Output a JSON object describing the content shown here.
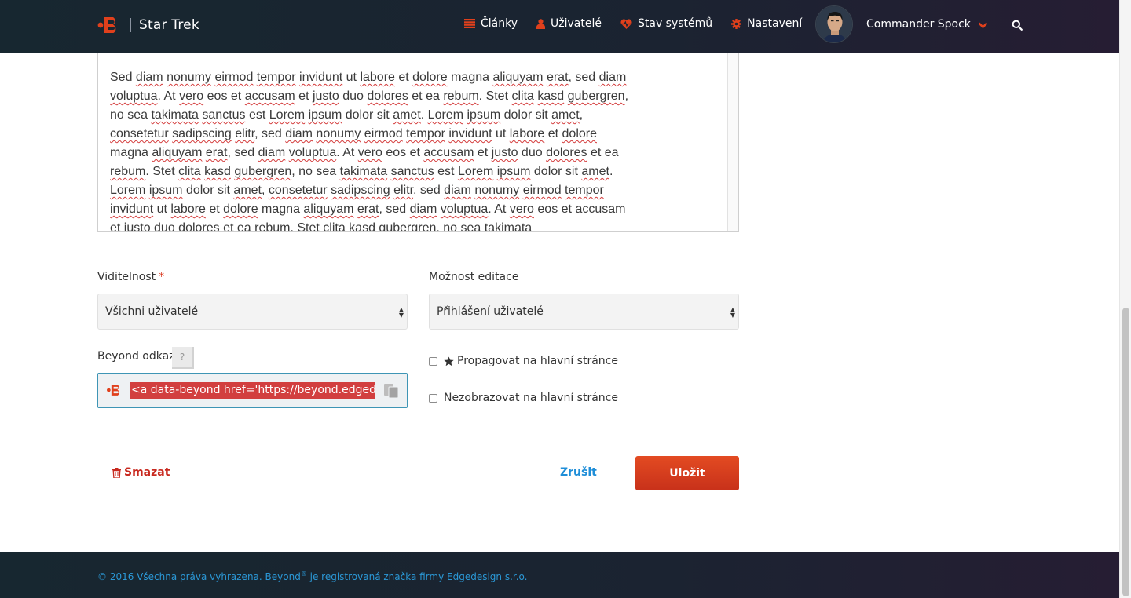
{
  "header": {
    "brand_title": "Star Trek",
    "nav": [
      {
        "label": "Články",
        "icon": "list-icon"
      },
      {
        "label": "Uživatelé",
        "icon": "user-icon"
      },
      {
        "label": "Stav systémů",
        "icon": "heartbeat-icon"
      },
      {
        "label": "Nastavení",
        "icon": "gear-icon"
      }
    ],
    "user_name": "Commander Spock",
    "accent_color": "#e0401c"
  },
  "editor": {
    "paragraph": [
      {
        "t": "Sed ",
        "s": false
      },
      {
        "t": "diam",
        "s": true
      },
      {
        "t": " ",
        "s": false
      },
      {
        "t": "nonumy",
        "s": true
      },
      {
        "t": " ",
        "s": false
      },
      {
        "t": "eirmod",
        "s": true
      },
      {
        "t": " ",
        "s": false
      },
      {
        "t": "tempor",
        "s": true
      },
      {
        "t": " ",
        "s": false
      },
      {
        "t": "invidunt",
        "s": true
      },
      {
        "t": " ut ",
        "s": false
      },
      {
        "t": "labore",
        "s": true
      },
      {
        "t": " et ",
        "s": false
      },
      {
        "t": "dolore",
        "s": true
      },
      {
        "t": " magna ",
        "s": false
      },
      {
        "t": "aliquyam",
        "s": true
      },
      {
        "t": " ",
        "s": false
      },
      {
        "t": "erat",
        "s": true
      },
      {
        "t": ", sed ",
        "s": false
      },
      {
        "t": "diam",
        "s": true
      },
      {
        "t": " ",
        "s": false
      },
      {
        "t": "voluptua",
        "s": true
      },
      {
        "t": ". At ",
        "s": false
      },
      {
        "t": "vero",
        "s": true
      },
      {
        "t": " eos et ",
        "s": false
      },
      {
        "t": "accusam",
        "s": true
      },
      {
        "t": " et ",
        "s": false
      },
      {
        "t": "justo",
        "s": true
      },
      {
        "t": " duo ",
        "s": false
      },
      {
        "t": "dolores",
        "s": true
      },
      {
        "t": " et ea ",
        "s": false
      },
      {
        "t": "rebum",
        "s": true
      },
      {
        "t": ". Stet ",
        "s": false
      },
      {
        "t": "clita",
        "s": true
      },
      {
        "t": " ",
        "s": false
      },
      {
        "t": "kasd",
        "s": true
      },
      {
        "t": " ",
        "s": false
      },
      {
        "t": "gubergren",
        "s": true
      },
      {
        "t": ", no sea ",
        "s": false
      },
      {
        "t": "takimata",
        "s": true
      },
      {
        "t": " ",
        "s": false
      },
      {
        "t": "sanctus",
        "s": true
      },
      {
        "t": " est ",
        "s": false
      },
      {
        "t": "Lorem",
        "s": true
      },
      {
        "t": " ",
        "s": false
      },
      {
        "t": "ipsum",
        "s": true
      },
      {
        "t": " dolor sit ",
        "s": false
      },
      {
        "t": "amet",
        "s": true
      },
      {
        "t": ". ",
        "s": false
      },
      {
        "t": "Lorem",
        "s": true
      },
      {
        "t": " ",
        "s": false
      },
      {
        "t": "ipsum",
        "s": true
      },
      {
        "t": " dolor sit ",
        "s": false
      },
      {
        "t": "amet",
        "s": true
      },
      {
        "t": ", ",
        "s": false
      },
      {
        "t": "consetetur",
        "s": true
      },
      {
        "t": " ",
        "s": false
      },
      {
        "t": "sadipscing",
        "s": true
      },
      {
        "t": " ",
        "s": false
      },
      {
        "t": "elitr",
        "s": true
      },
      {
        "t": ", sed ",
        "s": false
      },
      {
        "t": "diam",
        "s": true
      },
      {
        "t": " ",
        "s": false
      },
      {
        "t": "nonumy",
        "s": true
      },
      {
        "t": " ",
        "s": false
      },
      {
        "t": "eirmod",
        "s": true
      },
      {
        "t": " ",
        "s": false
      },
      {
        "t": "tempor",
        "s": true
      },
      {
        "t": " ",
        "s": false
      },
      {
        "t": "invidunt",
        "s": true
      },
      {
        "t": " ut ",
        "s": false
      },
      {
        "t": "labore",
        "s": true
      },
      {
        "t": " et ",
        "s": false
      },
      {
        "t": "dolore",
        "s": true
      },
      {
        "t": " magna ",
        "s": false
      },
      {
        "t": "aliquyam",
        "s": true
      },
      {
        "t": " ",
        "s": false
      },
      {
        "t": "erat",
        "s": true
      },
      {
        "t": ", sed ",
        "s": false
      },
      {
        "t": "diam",
        "s": true
      },
      {
        "t": " ",
        "s": false
      },
      {
        "t": "voluptua",
        "s": true
      },
      {
        "t": ". At ",
        "s": false
      },
      {
        "t": "vero",
        "s": true
      },
      {
        "t": " eos et ",
        "s": false
      },
      {
        "t": "accusam",
        "s": true
      },
      {
        "t": " et ",
        "s": false
      },
      {
        "t": "justo",
        "s": true
      },
      {
        "t": " duo ",
        "s": false
      },
      {
        "t": "dolores",
        "s": true
      },
      {
        "t": " et ea ",
        "s": false
      },
      {
        "t": "rebum",
        "s": true
      },
      {
        "t": ". Stet ",
        "s": false
      },
      {
        "t": "clita",
        "s": true
      },
      {
        "t": " ",
        "s": false
      },
      {
        "t": "kasd",
        "s": true
      },
      {
        "t": " ",
        "s": false
      },
      {
        "t": "gubergren",
        "s": true
      },
      {
        "t": ", no sea ",
        "s": false
      },
      {
        "t": "takimata",
        "s": true
      },
      {
        "t": " ",
        "s": false
      },
      {
        "t": "sanctus",
        "s": true
      },
      {
        "t": " est ",
        "s": false
      },
      {
        "t": "Lorem",
        "s": true
      },
      {
        "t": " ",
        "s": false
      },
      {
        "t": "ipsum",
        "s": true
      },
      {
        "t": " ",
        "s": false
      },
      {
        "t": "dolor sit ",
        "s": false
      },
      {
        "t": "amet",
        "s": true
      },
      {
        "t": ". ",
        "s": false
      },
      {
        "t": "Lorem",
        "s": true
      },
      {
        "t": " ",
        "s": false
      },
      {
        "t": "ipsum",
        "s": true
      },
      {
        "t": " dolor sit ",
        "s": false
      },
      {
        "t": "amet",
        "s": true
      },
      {
        "t": ", ",
        "s": false
      },
      {
        "t": "consetetur",
        "s": true
      },
      {
        "t": " ",
        "s": false
      },
      {
        "t": "sadipscing",
        "s": true
      },
      {
        "t": " ",
        "s": false
      },
      {
        "t": "elitr",
        "s": true
      },
      {
        "t": ", sed ",
        "s": false
      },
      {
        "t": "diam",
        "s": true
      },
      {
        "t": " ",
        "s": false
      },
      {
        "t": "nonumy",
        "s": true
      },
      {
        "t": " ",
        "s": false
      },
      {
        "t": "eirmod",
        "s": true
      },
      {
        "t": " ",
        "s": false
      },
      {
        "t": "tempor",
        "s": true
      },
      {
        "t": " ",
        "s": false
      },
      {
        "t": "invidunt",
        "s": true
      },
      {
        "t": " ut ",
        "s": false
      },
      {
        "t": "labore",
        "s": true
      },
      {
        "t": " et ",
        "s": false
      },
      {
        "t": "dolore",
        "s": true
      },
      {
        "t": " magna ",
        "s": false
      },
      {
        "t": "aliquyam",
        "s": true
      },
      {
        "t": " ",
        "s": false
      },
      {
        "t": "erat",
        "s": true
      },
      {
        "t": ", sed ",
        "s": false
      },
      {
        "t": "diam",
        "s": true
      },
      {
        "t": " ",
        "s": false
      },
      {
        "t": "voluptua",
        "s": true
      },
      {
        "t": ". At ",
        "s": false
      },
      {
        "t": "vero",
        "s": true
      },
      {
        "t": " ",
        "s": false
      },
      {
        "t": "eos et accusam et justo duo dolores et ea rebum. Stet clita kasd gubergren, no sea takimata",
        "s": false
      }
    ]
  },
  "form": {
    "visibility": {
      "label": "Viditelnost",
      "required_mark": "*",
      "value": "Všichni uživatelé"
    },
    "edit_option": {
      "label": "Možnost editace",
      "value": "Přihlášení uživatelé"
    },
    "beyond_link": {
      "label": "Beyond odkaz",
      "help": "?",
      "value": "<a data-beyond href='https://beyond.edgedesig"
    },
    "promote": {
      "label": "Propagovat na hlavní stránce",
      "checked": false
    },
    "hide": {
      "label": "Nezobrazovat na hlavní stránce",
      "checked": false
    }
  },
  "actions": {
    "delete_label": "Smazat",
    "cancel_label": "Zrušit",
    "save_label": "Uložit"
  },
  "footer": {
    "text_before": "© 2016 Všechna práva vyhrazena. Beyond",
    "registered": "®",
    "text_after": " je registrovaná značka firmy Edgedesign s.r.o."
  }
}
